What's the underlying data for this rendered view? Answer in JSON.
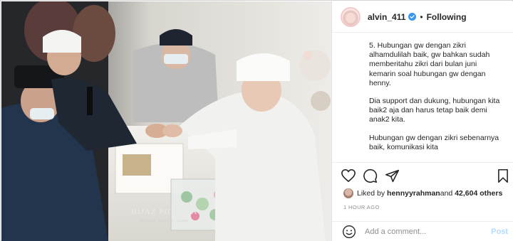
{
  "post": {
    "username": "alvin_411",
    "separator": "•",
    "follow_label": "Following",
    "watermark": "HIJAZ PICTURA",
    "watermark_sub": "WEDDING · MOMENT · STORY"
  },
  "caption": {
    "paragraphs": [
      "5. Hubungan gw dengan zikri alhamdulilah baik, gw bahkan sudah memberitahu zikri dari bulan juni kemarin soal hubungan gw dengan henny.",
      "Dia support dan dukung, hubungan kita baik2 aja dan harus tetap baik demi anak2 kita.",
      "Hubungan gw dengan zikri sebenarnya baik, komunikasi kita"
    ]
  },
  "likes": {
    "prefix": "Liked by ",
    "user": "hennyyrahman",
    "middle": " and ",
    "count": "42,604 others"
  },
  "timestamp": "1 HOUR AGO",
  "comment": {
    "placeholder": "Add a comment...",
    "post_label": "Post"
  },
  "colors": {
    "verified": "#3897f0",
    "post_disabled": "#b3dbff",
    "muted": "#8e8e8e"
  }
}
